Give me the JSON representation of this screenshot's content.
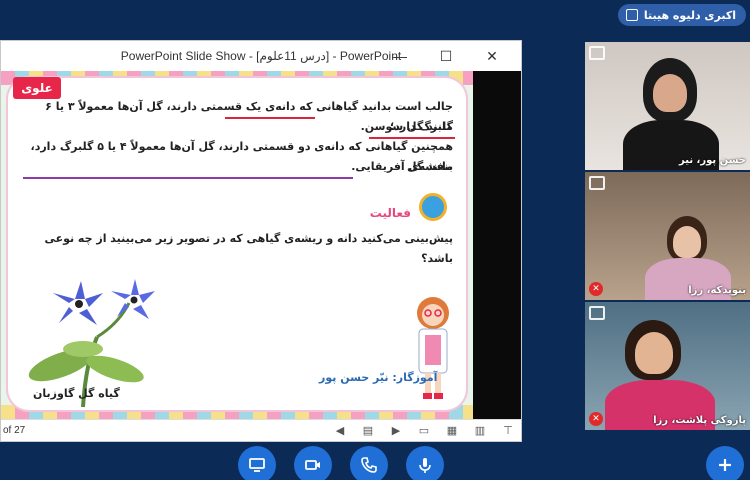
{
  "presenter_badge": {
    "label": "اکبری دلیوه هیبتا"
  },
  "ppt": {
    "title": "PowerPoint Slide Show - [درس 11علوم] - PowerPoint",
    "controls": {
      "minimize": "—",
      "maximize": "☐",
      "close": "✕"
    },
    "slide_counter": "of 27"
  },
  "slide": {
    "logo": "علوی",
    "line1": "جالب است بدانید گیاهانی که دانه‌ی یک قسمتی دارند، گل آن‌ها معمولاً ۳ یا ۶ گلبرگ دارد؛",
    "line2": "مانند گل سوسن.",
    "line3": "همچنین گیاهانی که دانه‌ی دو قسمتی دارند، گل آن‌ها معمولاً ۴ یا ۵ گلبرگ دارد، مانند گل",
    "line4": "بنفشه‌ی آفریقایی.",
    "activity": "فعالیت",
    "question": "پیش‌بینی می‌کنید دانه و ریشه‌ی گیاهی که در تصویر زیر می‌بینید از چه نوعی باشد؟",
    "caption": "گیاه گل گاوزبان",
    "teacher": "آموزگار: نیّر حسن پور"
  },
  "participants": [
    {
      "name": "حسن پور، نیر",
      "muted": false
    },
    {
      "name": "بنویدکه، رزا",
      "muted": true
    },
    {
      "name": "پاروکی پلاشت، رزا",
      "muted": true
    }
  ],
  "colors": {
    "accent": "#1f6fd6",
    "background": "#0c2a56",
    "mute": "#e02a2a"
  }
}
